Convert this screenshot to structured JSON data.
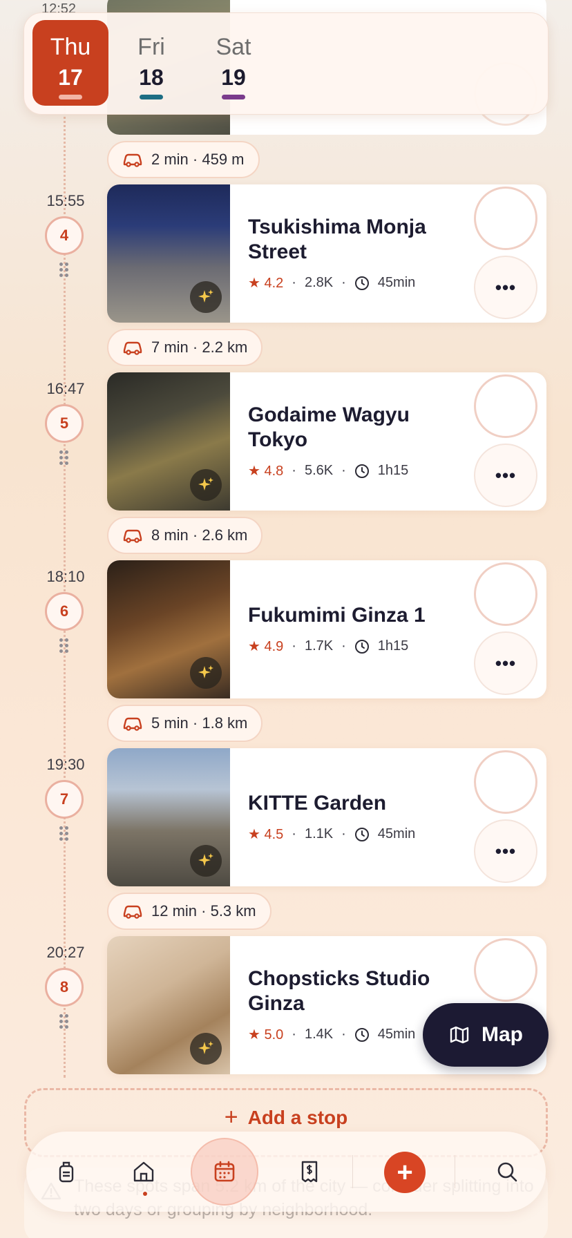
{
  "day_tabs": [
    {
      "name": "Thu",
      "num": "17",
      "bar_color": "#f2b5a5",
      "active": true
    },
    {
      "name": "Fri",
      "num": "18",
      "bar_color": "#1d6e84",
      "active": false
    },
    {
      "name": "Sat",
      "num": "19",
      "bar_color": "#7a3b8c",
      "active": false
    }
  ],
  "top_partial": {
    "time": "12:52"
  },
  "travel": [
    {
      "label": "2 min · 459 m"
    },
    {
      "label": "7 min · 2.2 km"
    },
    {
      "label": "8 min · 2.6 km"
    },
    {
      "label": "5 min · 1.8 km"
    },
    {
      "label": "12 min · 5.3 km"
    }
  ],
  "stops": [
    {
      "time": "15:55",
      "num": "4",
      "name": "Tsukishima Monja Street",
      "rating": "★ 4.2",
      "reviews": "2.8K",
      "duration": "45min",
      "more": "•••"
    },
    {
      "time": "16:47",
      "num": "5",
      "name": "Godaime Wagyu Tokyo",
      "rating": "★ 4.8",
      "reviews": "5.6K",
      "duration": "1h15",
      "more": "•••"
    },
    {
      "time": "18:10",
      "num": "6",
      "name": "Fukumimi Ginza 1",
      "rating": "★ 4.9",
      "reviews": "1.7K",
      "duration": "1h15",
      "more": "•••"
    },
    {
      "time": "19:30",
      "num": "7",
      "name": "KITTE Garden",
      "rating": "★ 4.5",
      "reviews": "1.1K",
      "duration": "45min",
      "more": "•••"
    },
    {
      "time": "20:27",
      "num": "8",
      "name": "Chopsticks Studio Ginza",
      "rating": "★ 5.0",
      "reviews": "1.4K",
      "duration": "45min",
      "more": "•••"
    }
  ],
  "add_stop": {
    "plus": "+",
    "label": "Add a stop"
  },
  "warning": {
    "text": "These spots span 5.2 km of the city — consider splitting into two days or grouping by neighborhood."
  },
  "map_button": {
    "label": "Map"
  },
  "nav": {
    "add_symbol": "+"
  },
  "separator": "·",
  "colors": {
    "accent": "#c8401f",
    "navy": "#1c1a33",
    "card_bg": "#ffffff"
  }
}
